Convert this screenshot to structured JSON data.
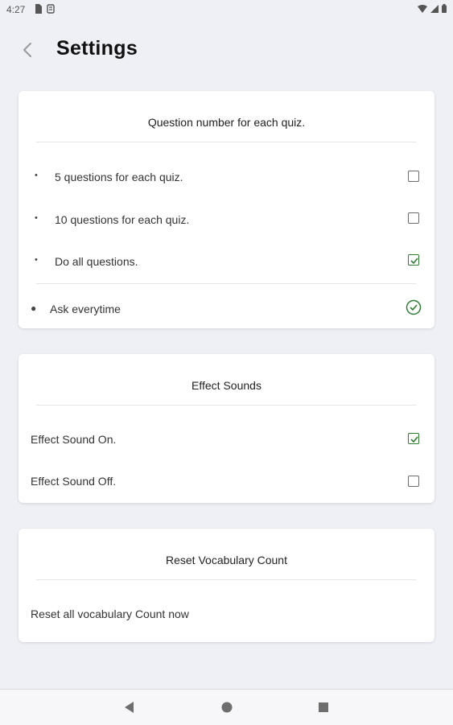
{
  "status_bar": {
    "time": "4:27"
  },
  "header": {
    "title": "Settings"
  },
  "quiz_card": {
    "title": "Question number for each quiz.",
    "options": [
      {
        "label": "5 questions for each quiz.",
        "checked": false
      },
      {
        "label": "10 questions for each quiz.",
        "checked": false
      },
      {
        "label": "Do all questions.",
        "checked": true
      }
    ],
    "ask_label": "Ask everytime",
    "ask_checked": true
  },
  "sound_card": {
    "title": "Effect Sounds",
    "on_label": "Effect Sound On.",
    "on_checked": true,
    "off_label": "Effect Sound Off.",
    "off_checked": false
  },
  "reset_card": {
    "title": "Reset Vocabulary Count",
    "action_label": "Reset all vocabulary Count now"
  },
  "colors": {
    "accent": "#2e7d32",
    "background": "#eef0f5",
    "card": "#ffffff"
  }
}
